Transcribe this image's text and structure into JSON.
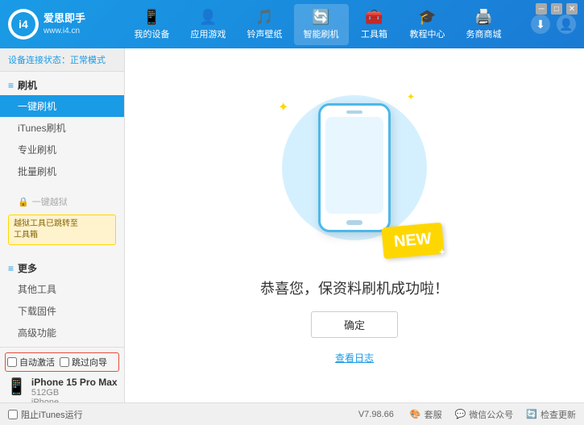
{
  "app": {
    "logo_short": "i4",
    "logo_name": "爱思即手",
    "logo_url": "www.i4.cn"
  },
  "header": {
    "tabs": [
      {
        "id": "my-device",
        "label": "我的设备",
        "icon": "📱"
      },
      {
        "id": "apps-games",
        "label": "应用游戏",
        "icon": "👤"
      },
      {
        "id": "ringtones",
        "label": "铃声壁纸",
        "icon": "🎵"
      },
      {
        "id": "smart-flash",
        "label": "智能刷机",
        "icon": "🔄",
        "active": true
      },
      {
        "id": "toolbox",
        "label": "工具箱",
        "icon": "🧰"
      },
      {
        "id": "tutorials",
        "label": "教程中心",
        "icon": "🎓"
      },
      {
        "id": "services",
        "label": "务商商城",
        "icon": "🖨️"
      }
    ]
  },
  "sidebar": {
    "status_label": "设备连接状态：",
    "status_value": "正常模式",
    "flash_group": "刷机",
    "items": [
      {
        "id": "one-key-flash",
        "label": "一键刷机",
        "active": true
      },
      {
        "id": "itunes-flash",
        "label": "iTunes刷机"
      },
      {
        "id": "pro-flash",
        "label": "专业刷机"
      },
      {
        "id": "batch-flash",
        "label": "批量刷机"
      }
    ],
    "disabled_item": {
      "icon": "🔒",
      "label": "一键越狱"
    },
    "notice": "越狱工具已跳转至\n工具箱",
    "more_group": "更多",
    "more_items": [
      {
        "id": "other-tools",
        "label": "其他工具"
      },
      {
        "id": "download-firmware",
        "label": "下载固件"
      },
      {
        "id": "advanced",
        "label": "高级功能"
      }
    ],
    "auto_activate": "自动激活",
    "guided_activation": "跳过向导",
    "device": {
      "name": "iPhone 15 Pro Max",
      "storage": "512GB",
      "type": "iPhone"
    }
  },
  "content": {
    "new_badge": "NEW",
    "success_message": "恭喜您，保资料刷机成功啦！",
    "confirm_button": "确定",
    "log_link": "查看日志"
  },
  "footer": {
    "version": "V7.98.66",
    "items": [
      {
        "id": "skin",
        "label": "套服"
      },
      {
        "id": "wechat",
        "label": "微信公众号"
      },
      {
        "id": "check-update",
        "label": "检查更新"
      }
    ],
    "itunes_label": "阻止iTunes运行"
  },
  "window_controls": {
    "minimize": "─",
    "maximize": "□",
    "close": "✕"
  }
}
